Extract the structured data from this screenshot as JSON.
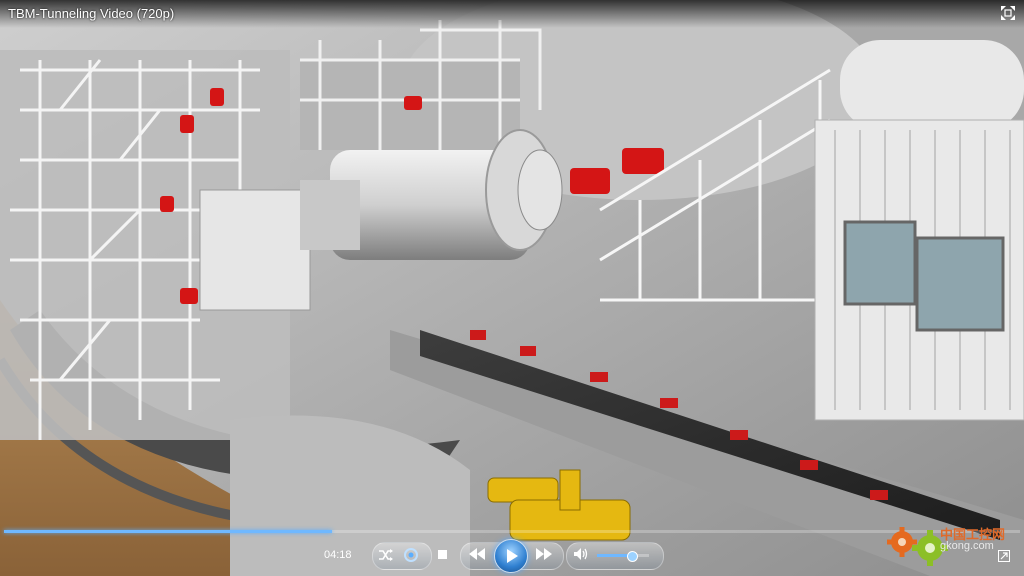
{
  "window": {
    "title": "TBM-Tunneling Video (720p)"
  },
  "player": {
    "current_time": "04:18",
    "progress_fraction": 0.323,
    "volume_fraction": 0.65,
    "icons": {
      "fullscreen": "fullscreen-icon",
      "shuffle": "shuffle-icon",
      "repeat": "repeat-icon",
      "stop": "stop-icon",
      "previous": "previous-icon",
      "play": "play-icon",
      "next": "next-icon",
      "volume": "volume-icon",
      "expand": "expand-icon"
    },
    "accent_color": "#5aaeff"
  },
  "watermark": {
    "text_cn": "中国工控网",
    "url": "gkong.com"
  }
}
